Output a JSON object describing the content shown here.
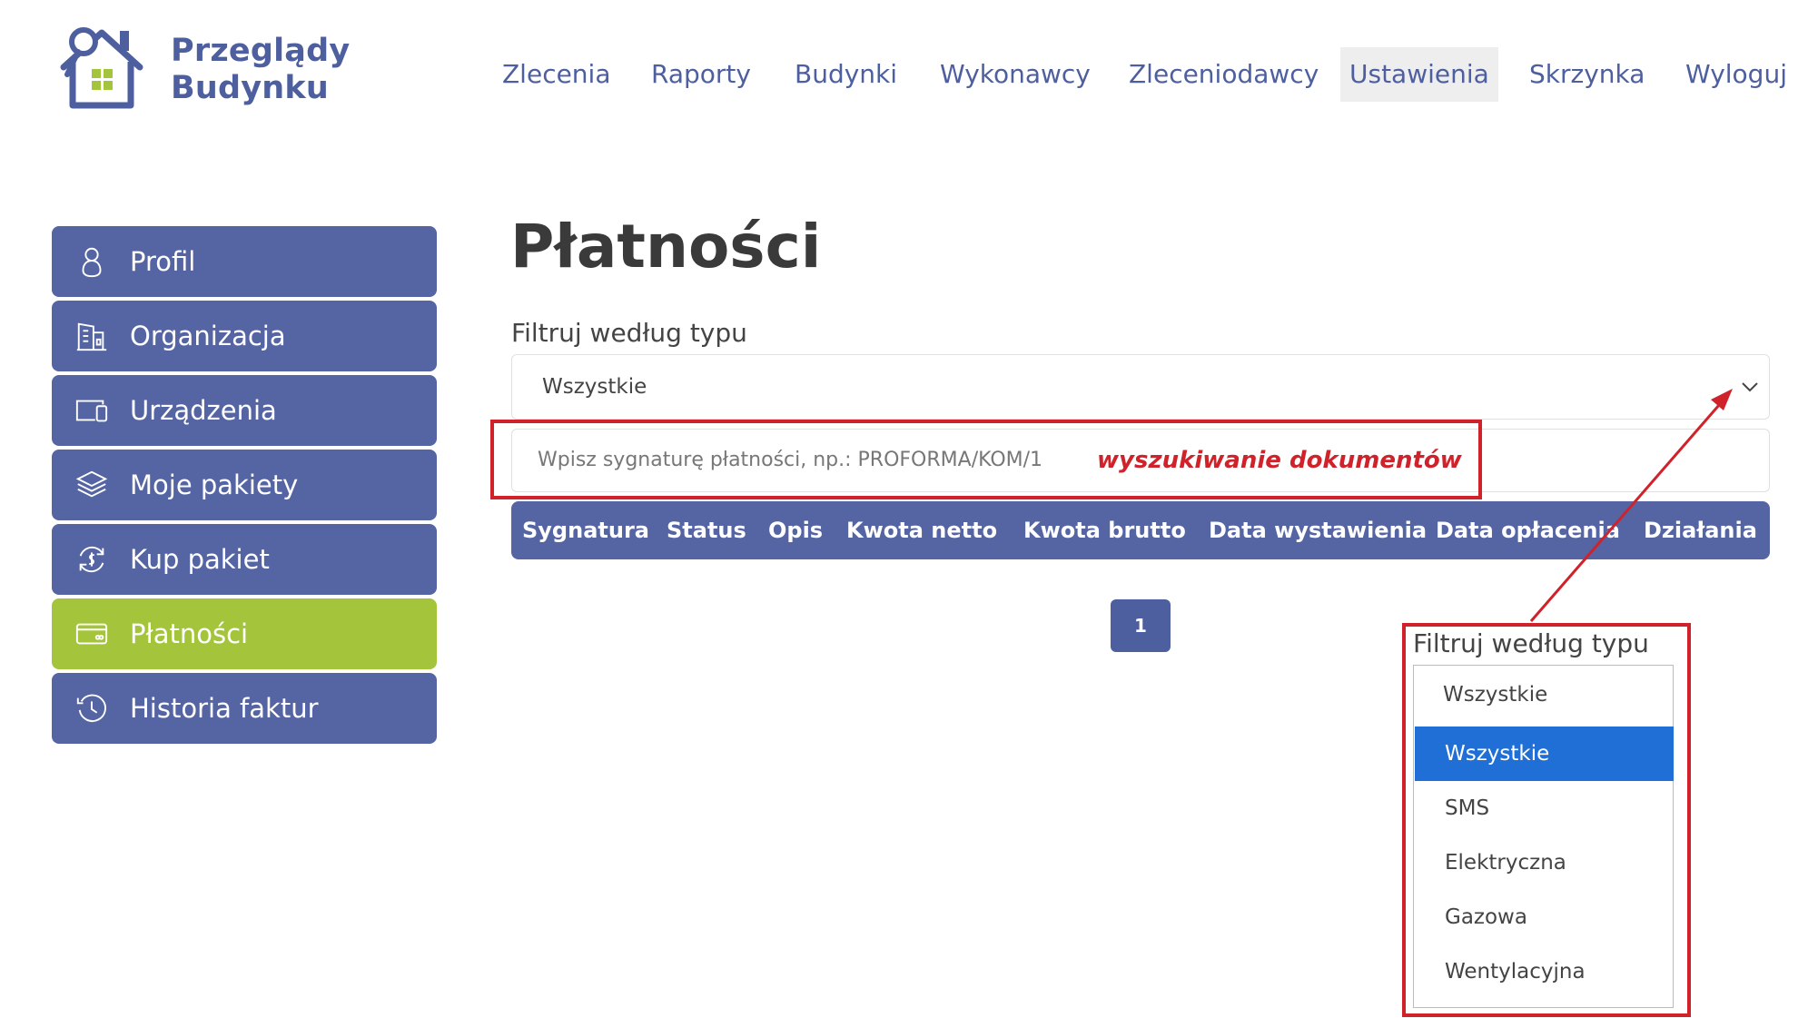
{
  "app": {
    "brand_line1": "Przeglądy",
    "brand_line2": "Budynku"
  },
  "nav": [
    {
      "label": "Zlecenia"
    },
    {
      "label": "Raporty"
    },
    {
      "label": "Budynki"
    },
    {
      "label": "Wykonawcy"
    },
    {
      "label": "Zleceniodawcy"
    },
    {
      "label": "Ustawienia",
      "active": true
    },
    {
      "label": "Skrzynka"
    },
    {
      "label": "Wyloguj"
    }
  ],
  "sidebar": {
    "items": [
      {
        "label": "Profil",
        "icon": "user-icon"
      },
      {
        "label": "Organizacja",
        "icon": "building-icon"
      },
      {
        "label": "Urządzenia",
        "icon": "devices-icon"
      },
      {
        "label": "Moje pakiety",
        "icon": "layers-icon"
      },
      {
        "label": "Kup pakiet",
        "icon": "refresh-dollar-icon"
      },
      {
        "label": "Płatności",
        "icon": "credit-card-icon",
        "active": true
      },
      {
        "label": "Historia faktur",
        "icon": "history-icon"
      }
    ]
  },
  "main": {
    "title": "Płatności",
    "filter_label": "Filtruj według typu",
    "filter_value": "Wszystkie",
    "search_placeholder": "Wpisz sygnaturę płatności, np.: PROFORMA/KOM/1",
    "search_annotation": "wyszukiwanie dokumentów",
    "columns": [
      "Sygnatura",
      "Status",
      "Opis",
      "Kwota netto",
      "Kwota brutto",
      "Data wystawienia",
      "Data opłacenia",
      "Działania"
    ],
    "page": "1"
  },
  "callout": {
    "label": "Filtruj według typu",
    "current": "Wszystkie",
    "options": [
      "Wszystkie",
      "SMS",
      "Elektryczna",
      "Gazowa",
      "Wentylacyjna"
    ],
    "selected_index": 0
  },
  "colors": {
    "primary": "#5565a4",
    "active": "#a3c43b",
    "annotation": "#d0222a",
    "selected": "#1f6fd6"
  }
}
